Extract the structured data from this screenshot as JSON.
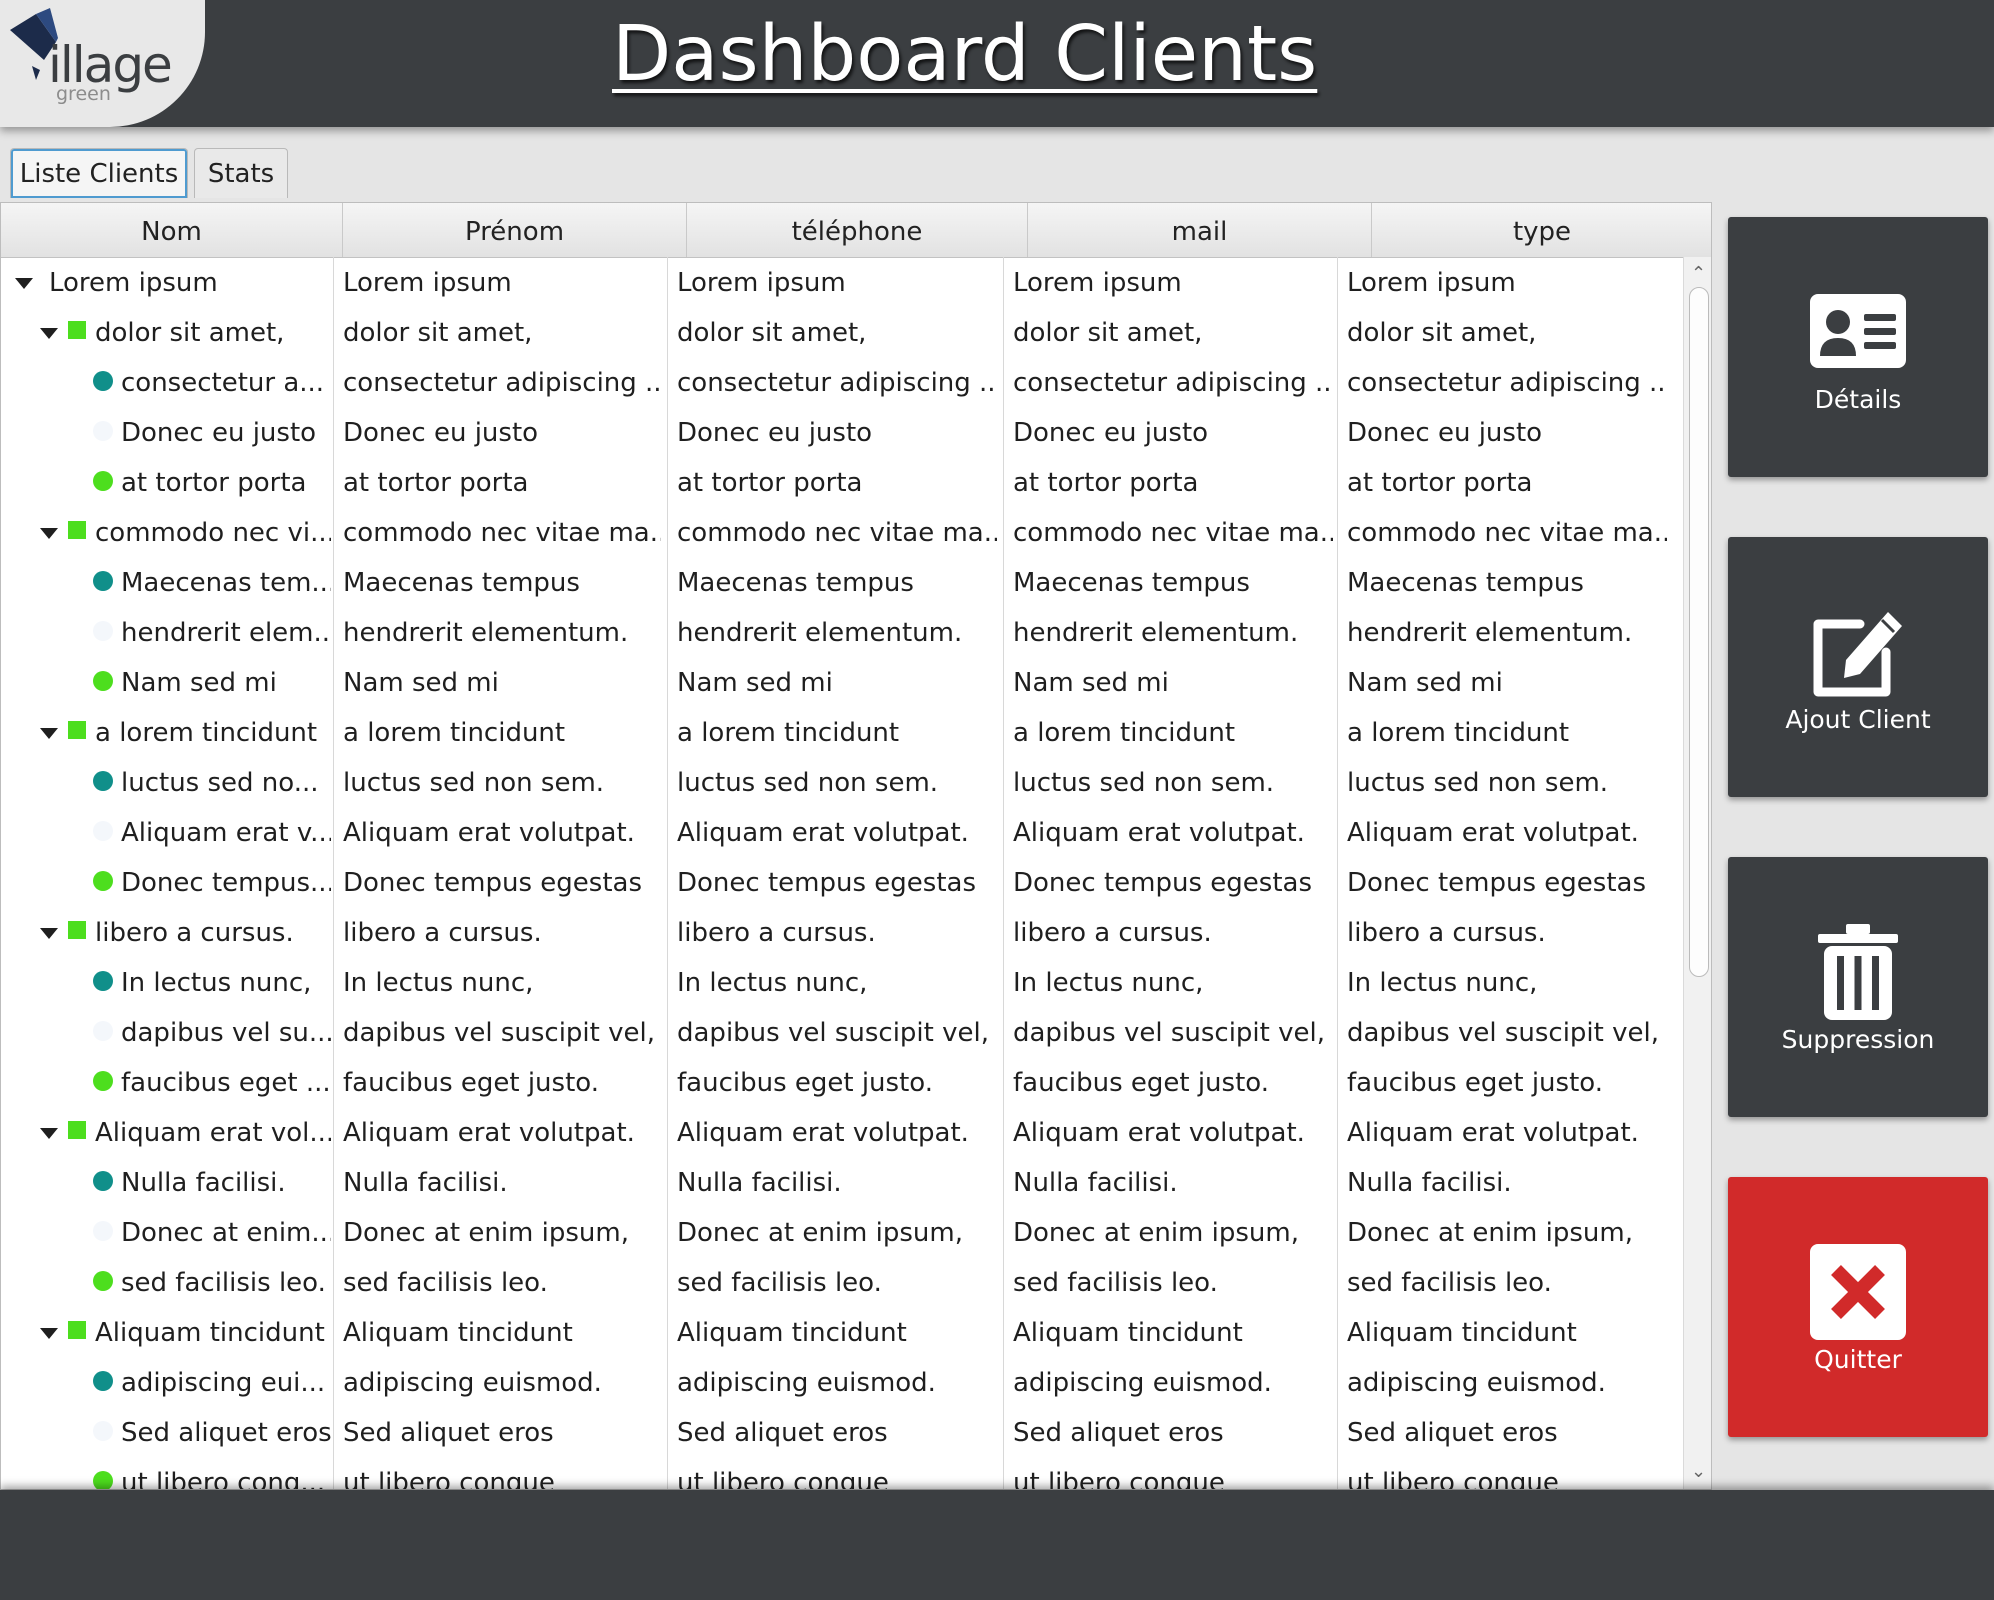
{
  "app": {
    "title": "Dashboard Clients",
    "logo_text": "illage",
    "logo_subtext": "green"
  },
  "tabs": [
    {
      "label": "Liste Clients",
      "selected": true
    },
    {
      "label": "Stats",
      "selected": false
    }
  ],
  "table": {
    "columns": [
      "Nom",
      "Prénom",
      "téléphone",
      "mail",
      "type"
    ],
    "rows": [
      {
        "level": 0,
        "icon": "expand-arrow",
        "nom": "Lorem ipsum",
        "prenom": "Lorem ipsum",
        "telephone": "Lorem ipsum",
        "mail": "Lorem ipsum",
        "type": "Lorem ipsum"
      },
      {
        "level": 1,
        "icon": "green-square",
        "nom": "dolor sit amet,",
        "prenom": "dolor sit amet,",
        "telephone": "dolor sit amet,",
        "mail": "dolor sit amet,",
        "type": "dolor sit amet,"
      },
      {
        "level": 2,
        "icon": "teal-dot",
        "nom": "consectetur a...",
        "prenom": "consectetur adipiscing ...",
        "telephone": "consectetur adipiscing ...",
        "mail": "consectetur adipiscing ...",
        "type": "consectetur adipiscing ..."
      },
      {
        "level": 2,
        "icon": "white-dot",
        "nom": "Donec eu justo",
        "prenom": "Donec eu justo",
        "telephone": "Donec eu justo",
        "mail": "Donec eu justo",
        "type": "Donec eu justo"
      },
      {
        "level": 2,
        "icon": "green-dot",
        "nom": "at tortor porta",
        "prenom": "at tortor porta",
        "telephone": "at tortor porta",
        "mail": "at tortor porta",
        "type": "at tortor porta"
      },
      {
        "level": 1,
        "icon": "green-square",
        "nom": "commodo nec vi...",
        "prenom": "commodo nec vitae ma...",
        "telephone": "commodo nec vitae ma...",
        "mail": "commodo nec vitae ma...",
        "type": "commodo nec vitae ma..."
      },
      {
        "level": 2,
        "icon": "teal-dot",
        "nom": "Maecenas tem...",
        "prenom": "Maecenas tempus",
        "telephone": "Maecenas tempus",
        "mail": "Maecenas tempus",
        "type": "Maecenas tempus"
      },
      {
        "level": 2,
        "icon": "white-dot",
        "nom": "hendrerit elem...",
        "prenom": "hendrerit elementum.",
        "telephone": "hendrerit elementum.",
        "mail": "hendrerit elementum.",
        "type": "hendrerit elementum."
      },
      {
        "level": 2,
        "icon": "green-dot",
        "nom": "Nam sed mi",
        "prenom": "Nam sed mi",
        "telephone": "Nam sed mi",
        "mail": "Nam sed mi",
        "type": "Nam sed mi"
      },
      {
        "level": 1,
        "icon": "green-square",
        "nom": "a lorem tincidunt",
        "prenom": "a lorem tincidunt",
        "telephone": "a lorem tincidunt",
        "mail": "a lorem tincidunt",
        "type": "a lorem tincidunt"
      },
      {
        "level": 2,
        "icon": "teal-dot",
        "nom": "luctus sed no...",
        "prenom": "luctus sed non sem.",
        "telephone": "luctus sed non sem.",
        "mail": "luctus sed non sem.",
        "type": "luctus sed non sem."
      },
      {
        "level": 2,
        "icon": "white-dot",
        "nom": "Aliquam erat v...",
        "prenom": "Aliquam erat volutpat.",
        "telephone": "Aliquam erat volutpat.",
        "mail": "Aliquam erat volutpat.",
        "type": "Aliquam erat volutpat."
      },
      {
        "level": 2,
        "icon": "green-dot",
        "nom": "Donec tempus...",
        "prenom": "Donec tempus egestas",
        "telephone": "Donec tempus egestas",
        "mail": "Donec tempus egestas",
        "type": "Donec tempus egestas"
      },
      {
        "level": 1,
        "icon": "green-square",
        "nom": "libero a cursus.",
        "prenom": "libero a cursus.",
        "telephone": "libero a cursus.",
        "mail": "libero a cursus.",
        "type": "libero a cursus."
      },
      {
        "level": 2,
        "icon": "teal-dot",
        "nom": "In lectus nunc,",
        "prenom": "In lectus nunc,",
        "telephone": "In lectus nunc,",
        "mail": "In lectus nunc,",
        "type": "In lectus nunc,"
      },
      {
        "level": 2,
        "icon": "white-dot",
        "nom": "dapibus vel su...",
        "prenom": "dapibus vel suscipit vel,",
        "telephone": "dapibus vel suscipit vel,",
        "mail": "dapibus vel suscipit vel,",
        "type": "dapibus vel suscipit vel,"
      },
      {
        "level": 2,
        "icon": "green-dot",
        "nom": "faucibus eget ...",
        "prenom": "faucibus eget justo.",
        "telephone": "faucibus eget justo.",
        "mail": "faucibus eget justo.",
        "type": "faucibus eget justo."
      },
      {
        "level": 1,
        "icon": "green-square",
        "nom": "Aliquam erat vol...",
        "prenom": "Aliquam erat volutpat.",
        "telephone": "Aliquam erat volutpat.",
        "mail": "Aliquam erat volutpat.",
        "type": "Aliquam erat volutpat."
      },
      {
        "level": 2,
        "icon": "teal-dot",
        "nom": "Nulla facilisi.",
        "prenom": "Nulla facilisi.",
        "telephone": "Nulla facilisi.",
        "mail": "Nulla facilisi.",
        "type": "Nulla facilisi."
      },
      {
        "level": 2,
        "icon": "white-dot",
        "nom": "Donec at enim...",
        "prenom": "Donec at enim ipsum,",
        "telephone": "Donec at enim ipsum,",
        "mail": "Donec at enim ipsum,",
        "type": "Donec at enim ipsum,"
      },
      {
        "level": 2,
        "icon": "green-dot",
        "nom": "sed facilisis leo.",
        "prenom": "sed facilisis leo.",
        "telephone": "sed facilisis leo.",
        "mail": "sed facilisis leo.",
        "type": "sed facilisis leo."
      },
      {
        "level": 1,
        "icon": "green-square",
        "nom": "Aliquam tincidunt",
        "prenom": "Aliquam tincidunt",
        "telephone": "Aliquam tincidunt",
        "mail": "Aliquam tincidunt",
        "type": "Aliquam tincidunt"
      },
      {
        "level": 2,
        "icon": "teal-dot",
        "nom": "adipiscing eui...",
        "prenom": "adipiscing euismod.",
        "telephone": "adipiscing euismod.",
        "mail": "adipiscing euismod.",
        "type": "adipiscing euismod."
      },
      {
        "level": 2,
        "icon": "white-dot",
        "nom": "Sed aliquet eros",
        "prenom": "Sed aliquet eros",
        "telephone": "Sed aliquet eros",
        "mail": "Sed aliquet eros",
        "type": "Sed aliquet eros"
      },
      {
        "level": 2,
        "icon": "green-dot",
        "nom": "ut libero cong...",
        "prenom": "ut libero congue",
        "telephone": "ut libero congue",
        "mail": "ut libero congue",
        "type": "ut libero congue"
      }
    ]
  },
  "actions": [
    {
      "label": "Détails",
      "icon": "id-card-icon"
    },
    {
      "label": "Ajout Client",
      "icon": "edit-icon"
    },
    {
      "label": "Suppression",
      "icon": "trash-icon"
    },
    {
      "label": "Quitter",
      "icon": "close-icon"
    }
  ],
  "colors": {
    "header_bg": "#3b3e41",
    "quit_red": "#d12a2a",
    "green_square": "#4dde1e",
    "teal_dot": "#108f8a",
    "green_dot": "#4dde1e",
    "white_dot": "#f4f7fb"
  }
}
